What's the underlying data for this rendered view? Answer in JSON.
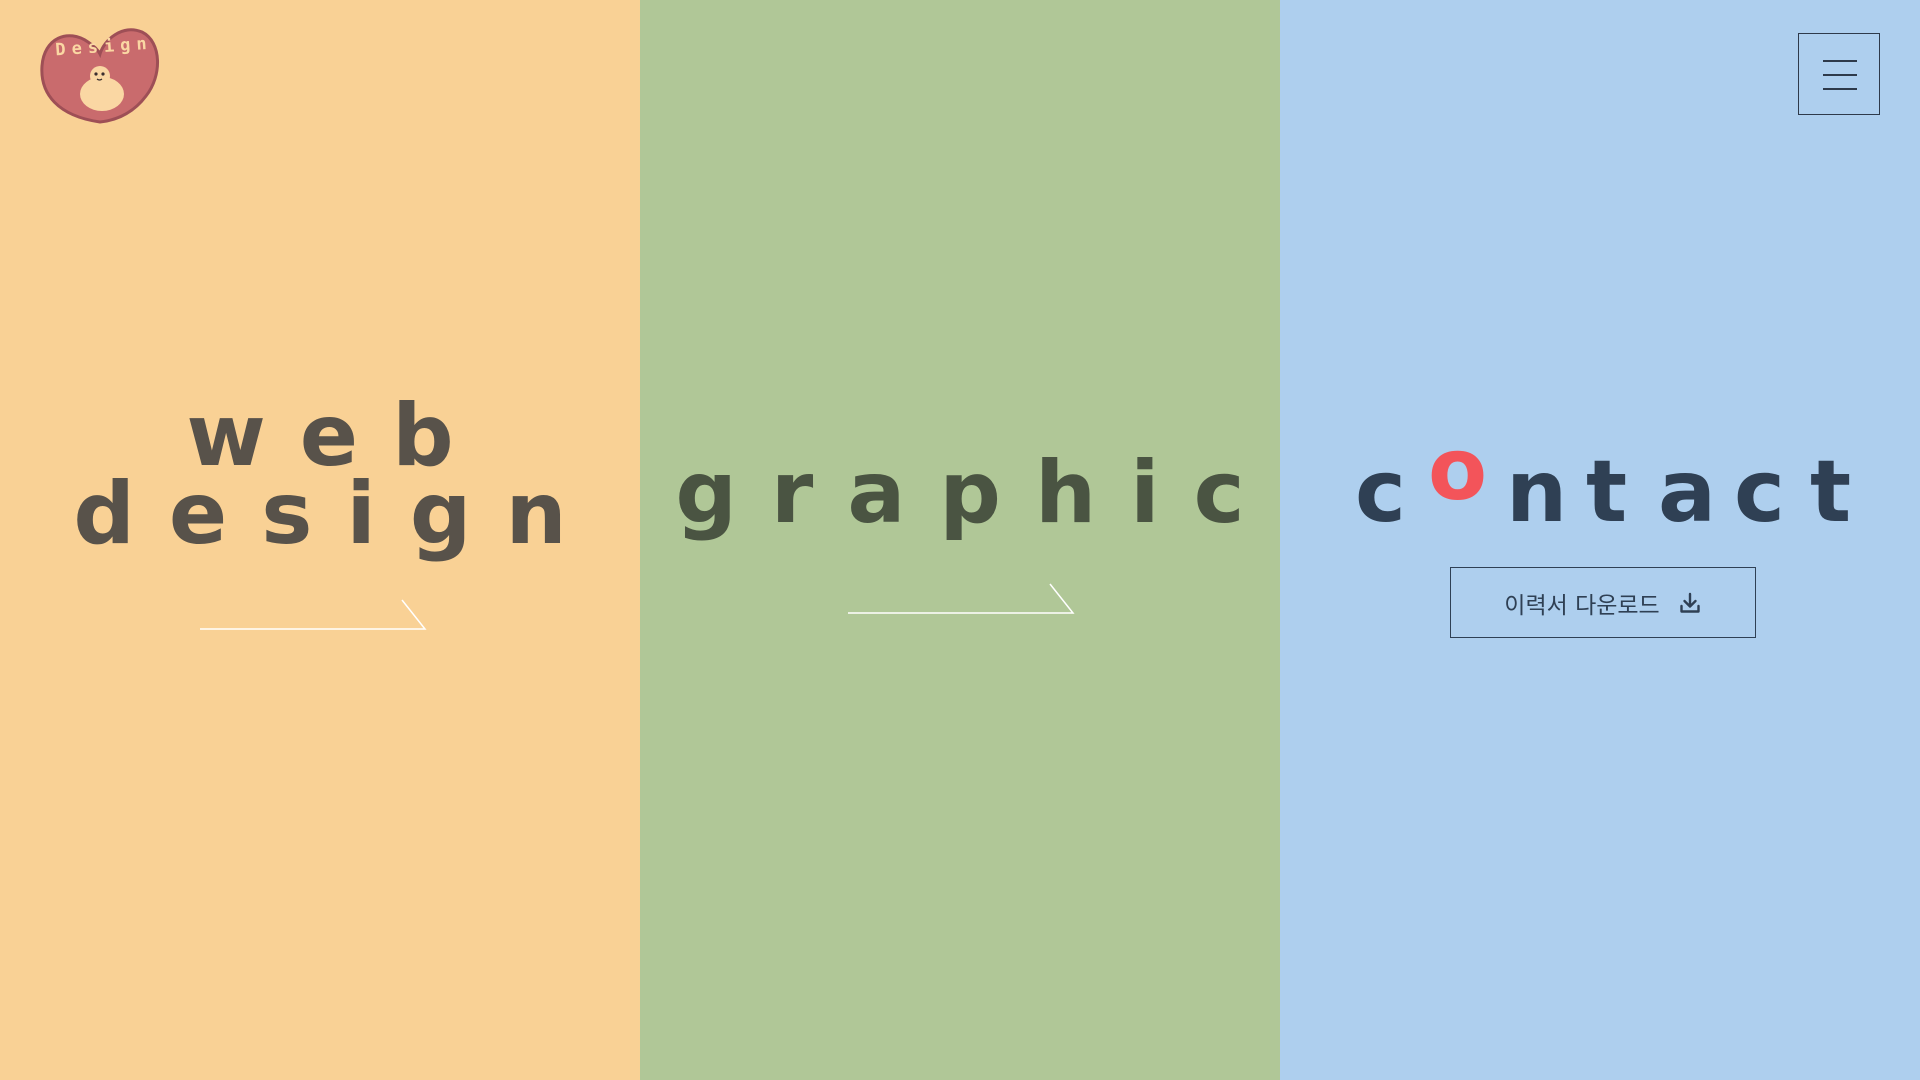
{
  "logo": {
    "text": "Design"
  },
  "menu": {
    "icon": "hamburger-menu-icon"
  },
  "panels": [
    {
      "id": "web",
      "title_line1": "web",
      "title_line2": "design",
      "background": "#F9D195",
      "text_color": "#58524A"
    },
    {
      "id": "graphic",
      "title": "graphic",
      "background": "#B0C797",
      "text_color": "#4A5442"
    },
    {
      "id": "contact",
      "title_letters": [
        "c",
        "o",
        "n",
        "t",
        "a",
        "c",
        "t"
      ],
      "background": "#AECFEE",
      "text_color": "#2F4054",
      "accent_color": "#F3545A",
      "resume_button_label": "이력서 다운로드",
      "resume_button_icon": "download-icon"
    }
  ]
}
